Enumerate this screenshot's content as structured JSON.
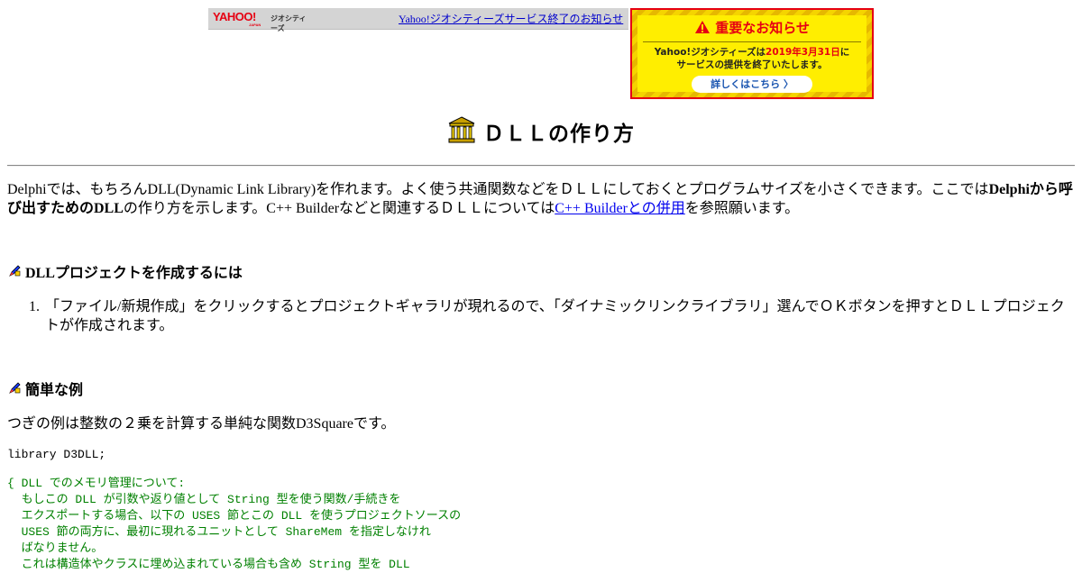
{
  "banner": {
    "logo_yahoo": "YAHOO!",
    "logo_japan": "JAPAN",
    "logo_geocities": "ジオシティーズ",
    "link_text": "Yahoo!ジオシティーズサービス終了のお知らせ"
  },
  "notice": {
    "title": "重要なお知らせ",
    "line1_prefix": "Yahoo!ジオシティーズは",
    "line1_date": "2019年3月31日",
    "line1_suffix": "に",
    "line2": "サービスの提供を終了いたします。",
    "button_label": "詳しくはこちら 〉",
    "colors": {
      "accent": "#e60012",
      "background": "#ffee00",
      "button_text": "#1a55b0"
    }
  },
  "page": {
    "title": "ＤＬＬの作り方",
    "title_icon": "temple-icon"
  },
  "intro": {
    "part1": "Delphiでは、もちろんDLL(Dynamic Link Library)を作れます。よく使う共通関数などをＤＬＬにしておくとプログラムサイズを小さくできます。ここでは",
    "bold": "Delphiから呼び出すためのDLL",
    "part2": "の作り方を示します。C++ Builderなどと関連するＤＬＬについては",
    "link": "C++ Builderとの併用",
    "part3": "を参照願います。"
  },
  "sections": [
    {
      "title": "DLLプロジェクトを作成するには",
      "icon": "pencil-icon"
    },
    {
      "title": "簡単な例",
      "icon": "pencil-icon"
    }
  ],
  "steps": [
    {
      "number": "1.",
      "text": "「ファイル/新規作成」をクリックするとプロジェクトギャラリが現れるので、「ダイナミックリンクライブラリ」選んでＯＫボタンを押すとＤＬＬプロジェクトが作成されます。"
    }
  ],
  "example_text": "つぎの例は整数の２乗を計算する単純な関数D3Squareです。",
  "code": {
    "line1": "library D3DLL;",
    "comment": "{ DLL でのメモリ管理について:\n  もしこの DLL が引数や返り値として String 型を使う関数/手続きを\n  エクスポートする場合、以下の USES 節とこの DLL を使うプロジェクトソースの\n  USES 節の両方に、最初に現れるユニットとして ShareMem を指定しなけれ\n  ばなりません。\n  これは構造体やクラスに埋め込まれている場合も含め String 型を DLL"
  }
}
